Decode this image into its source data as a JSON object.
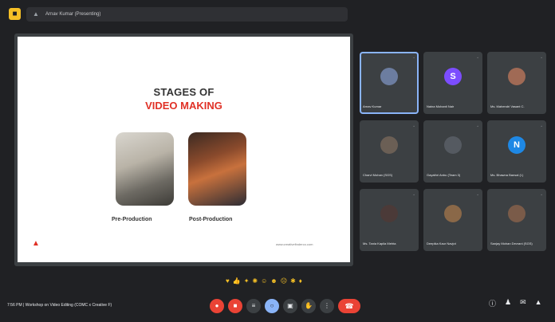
{
  "header": {
    "presenting_label": "Arnav Kumar (Presenting)"
  },
  "slide": {
    "title_line1": "STAGES OF",
    "title_line2": "VIDEO MAKING",
    "stage_left": "Pre-Production",
    "stage_right": "Post-Production",
    "footer": "www.creativefinderco.com"
  },
  "participants": [
    {
      "name": "Arnav Kumar",
      "initial": "",
      "avatar_color": "#6c7da0",
      "speaking": true
    },
    {
      "name": "Naina Mohanti Nair",
      "initial": "S",
      "avatar_color": "#7c4dff",
      "speaking": false
    },
    {
      "name": "Ms. Mahendri Vasant C.",
      "initial": "",
      "avatar_color": "#a06a55",
      "speaking": false
    },
    {
      "name": "Charvi Mohan (SGS)",
      "initial": "",
      "avatar_color": "#6b5f55",
      "speaking": false
    },
    {
      "name": "Gayathri Anbu (Team 3)",
      "initial": "",
      "avatar_color": "#555a61",
      "speaking": false
    },
    {
      "name": "Ms. Bhawna Bansal (I.)",
      "initial": "N",
      "avatar_color": "#1e88e5",
      "speaking": false
    },
    {
      "name": "Ms. Tania Kapila Mehta",
      "initial": "",
      "avatar_color": "#4b3a38",
      "speaking": false
    },
    {
      "name": "Deepika Kaur Navjot",
      "initial": "",
      "avatar_color": "#8a6848",
      "speaking": false
    },
    {
      "name": "Sanjay Mohan Devrani (SGS)",
      "initial": "",
      "avatar_color": "#7a5b49",
      "speaking": false
    }
  ],
  "footer": {
    "meeting_info": "7:56 PM  |  Workshop on Video Editing (COMC x Creative F)"
  },
  "icons": {
    "reactions": [
      "heart-icon",
      "thumbs-up-icon",
      "party-icon",
      "clap-icon",
      "laugh-icon",
      "surprised-icon",
      "sad-icon",
      "thinking-icon",
      "thumbs-down-icon"
    ],
    "controls": [
      "mic-off-icon",
      "camera-off-icon",
      "captions-icon",
      "emoji-icon",
      "present-icon",
      "raise-hand-icon",
      "more-icon",
      "end-call-icon"
    ],
    "right": [
      "info-icon",
      "people-icon",
      "chat-icon",
      "activities-icon"
    ]
  }
}
